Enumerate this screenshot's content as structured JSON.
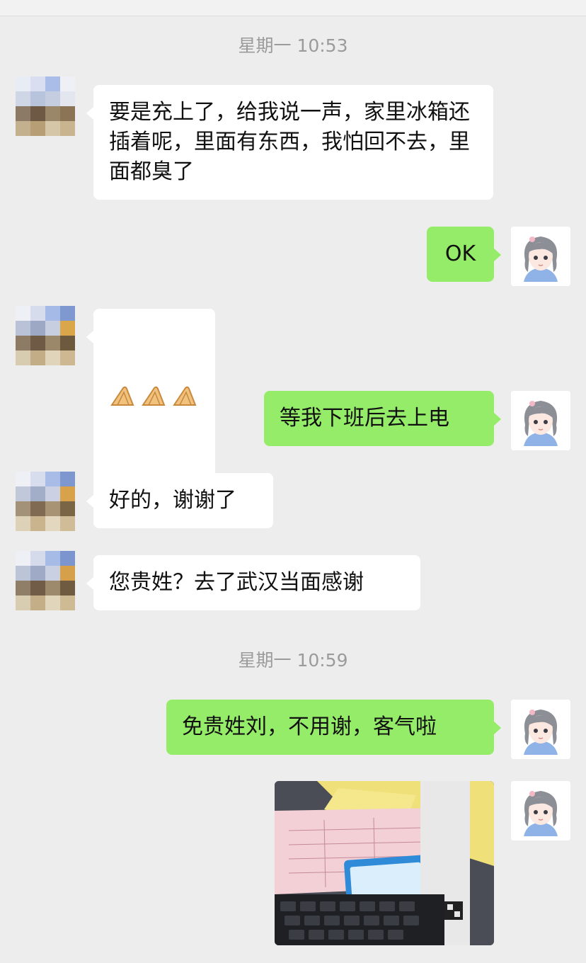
{
  "chat": {
    "timestamps": [
      "星期一 10:53",
      "星期一 10:59"
    ],
    "messages": [
      {
        "side": "in",
        "text": "要是充上了，给我说一声，家里冰箱还插着呢，里面有东西，我怕回不去，里面都臭了"
      },
      {
        "side": "out",
        "text": "OK"
      },
      {
        "side": "in",
        "emoji": [
          "clasped-hands-icon",
          "clasped-hands-icon",
          "clasped-hands-icon"
        ]
      },
      {
        "side": "out",
        "text": "等我下班后去上电"
      },
      {
        "side": "in",
        "text": "好的，谢谢了"
      },
      {
        "side": "in",
        "text": "您贵姓？去了武汉当面感谢"
      },
      {
        "side": "out",
        "text": "免贵姓刘，不用谢，客气啦"
      },
      {
        "side": "out",
        "image": "photo-of-receipt-and-card"
      }
    ]
  },
  "colors": {
    "background": "#ededed",
    "incoming_bubble": "#ffffff",
    "outgoing_bubble": "#95ec69",
    "timestamp_text": "#9b9b9b"
  }
}
